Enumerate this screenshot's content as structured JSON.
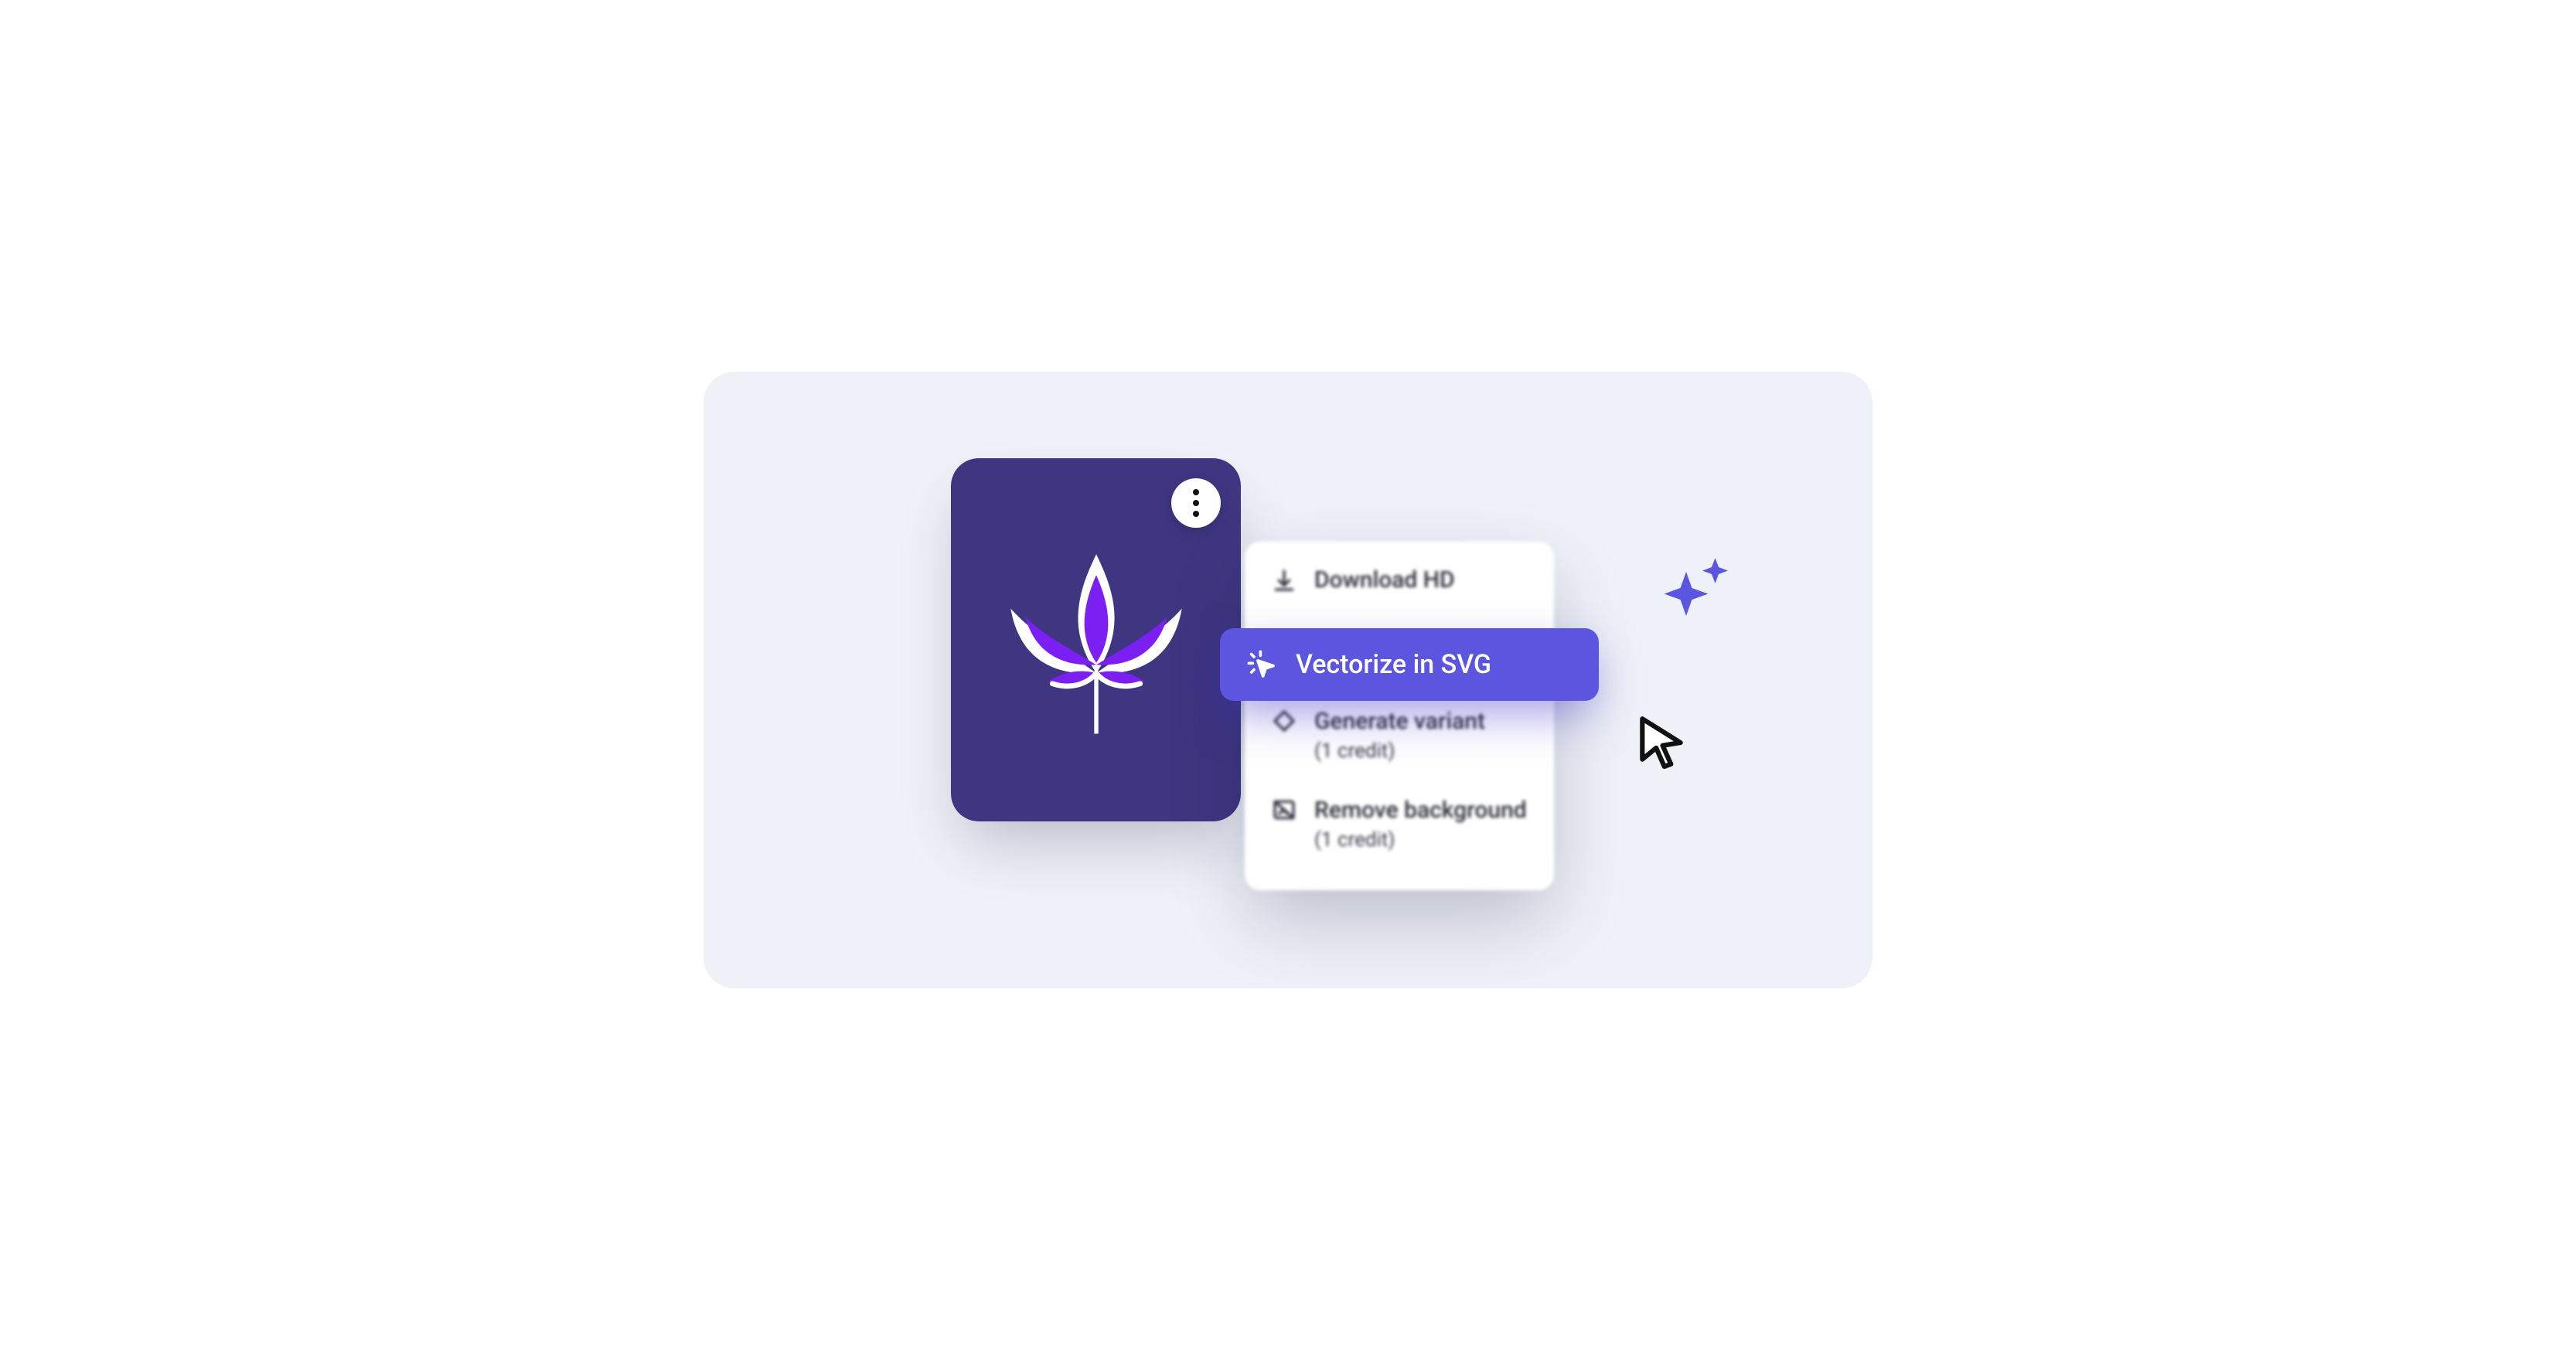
{
  "colors": {
    "stage_bg": "#EEF1F8",
    "card_bg": "#3E3680",
    "accent": "#5B55E0",
    "lotus_fill": "#7B1FF2",
    "text": "#2C2E3A"
  },
  "menu": {
    "download": {
      "label": "Download HD"
    },
    "vectorize": {
      "label": "Vectorize in SVG"
    },
    "variant": {
      "label": "Generate variant",
      "sub": "(1 credit)"
    },
    "removebg": {
      "label": "Remove background",
      "sub": "(1 credit)"
    }
  },
  "icons": {
    "kebab": "more-vertical",
    "download": "download",
    "vectorize": "magic-cursor",
    "variant": "diamond",
    "removebg": "image-off",
    "cursor": "cursor-arrow",
    "sparkle": "sparkle"
  }
}
